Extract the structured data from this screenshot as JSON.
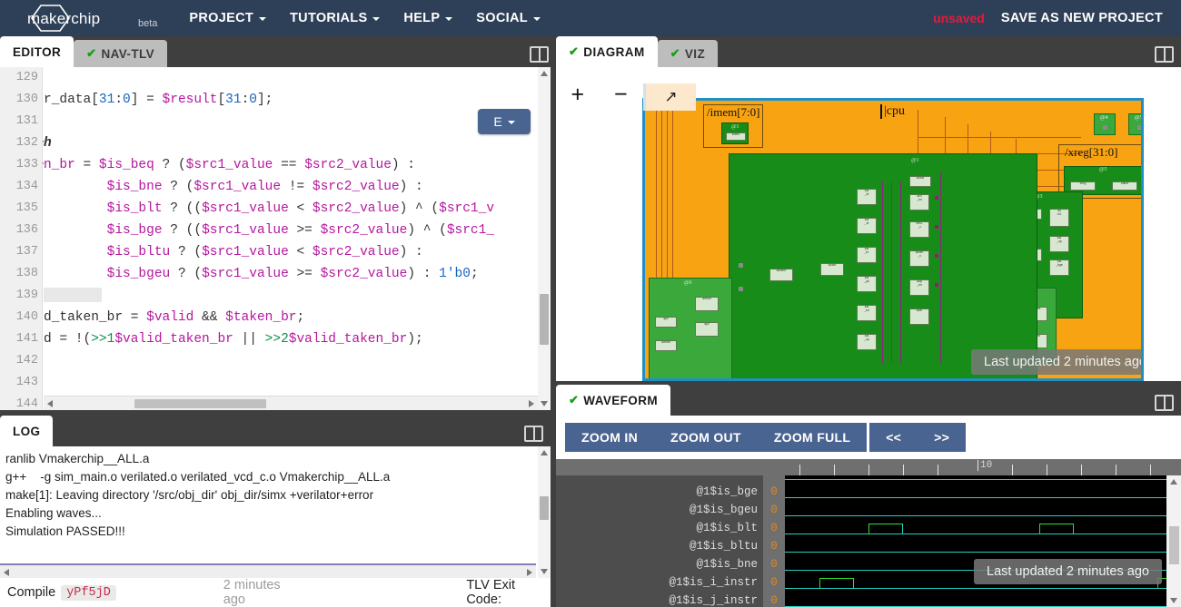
{
  "navbar": {
    "brand": "makerchip",
    "beta": "beta",
    "menus": [
      {
        "label": "PROJECT"
      },
      {
        "label": "TUTORIALS"
      },
      {
        "label": "HELP"
      },
      {
        "label": "SOCIAL"
      }
    ],
    "unsaved_label": "unsaved",
    "save_label": "SAVE AS NEW PROJECT",
    "unsaved_color": "#e8193c",
    "background": "#2e4057"
  },
  "editor": {
    "tabs": [
      {
        "label": "EDITOR",
        "active": true,
        "checked": false
      },
      {
        "label": "NAV-TLV",
        "active": false,
        "checked": true
      }
    ],
    "mode_button": "E",
    "line_numbers": [
      "129",
      "130",
      "131",
      "132",
      "133",
      "134",
      "135",
      "136",
      "137",
      "138",
      "139",
      "140",
      "141",
      "142",
      "143",
      "144"
    ],
    "lines": [
      {
        "num": "129",
        "fold": false,
        "text": ""
      },
      {
        "num": "130",
        "fold": false,
        "text": "r_data[31:0] = $result[31:0];"
      },
      {
        "num": "131",
        "fold": false,
        "text": ""
      },
      {
        "num": "132",
        "fold": true,
        "text": "h"
      },
      {
        "num": "133",
        "fold": true,
        "text": "n_br = $is_beq ? ($src1_value == $src2_value) :"
      },
      {
        "num": "134",
        "fold": false,
        "text": "        $is_bne ? ($src1_value != $src2_value) :"
      },
      {
        "num": "135",
        "fold": false,
        "text": "        $is_blt ? (($src1_value < $src2_value) ^ ($src1_v"
      },
      {
        "num": "136",
        "fold": false,
        "text": "        $is_bge ? (($src1_value >= $src2_value) ^ ($src1_"
      },
      {
        "num": "137",
        "fold": false,
        "text": "        $is_bltu ? ($src1_value < $src2_value) :"
      },
      {
        "num": "138",
        "fold": false,
        "text": "        $is_bgeu ? ($src1_value >= $src2_value) : 1'b0;"
      },
      {
        "num": "139",
        "fold": false,
        "text": ""
      },
      {
        "num": "140",
        "fold": false,
        "text": "d_taken_br = $valid && $taken_br;"
      },
      {
        "num": "141",
        "fold": false,
        "text": "d = !(>>1$valid_taken_br || >>2$valid_taken_br);"
      },
      {
        "num": "142",
        "fold": false,
        "text": ""
      },
      {
        "num": "143",
        "fold": false,
        "text": ""
      },
      {
        "num": "144",
        "fold": false,
        "text": ""
      }
    ]
  },
  "log": {
    "tab_label": "LOG",
    "text": "ranlib Vmakerchip__ALL.a\ng++    -g sim_main.o verilated.o verilated_vcd_c.o Vmakerchip__ALL.a\nmake[1]: Leaving directory '/src/obj_dir' obj_dir/simx +verilator+error\nEnabling waves...\nSimulation PASSED!!!",
    "status": {
      "compile_label": "Compile",
      "compile_id": "yPf5jD",
      "timestamp": "2 minutes ago",
      "exit_label": "TLV Exit Code:"
    }
  },
  "diagram": {
    "tabs": [
      {
        "label": "DIAGRAM",
        "active": true,
        "checked": true
      },
      {
        "label": "VIZ",
        "active": false,
        "checked": true
      }
    ],
    "controls": {
      "zoom_in": "+",
      "zoom_out": "−",
      "fit": "↗"
    },
    "canvas_color": "#f8a312",
    "border_color": "#1e90c8",
    "top_label": "|cpu",
    "block_labels": [
      "/xreg[31:0]",
      "/imem[7:0]"
    ],
    "stage_labels": [
      "@0",
      "@1",
      "@3",
      "@4",
      "@5"
    ],
    "toast": "Last updated 2 minutes ago"
  },
  "waveform": {
    "tab_label": "WAVEFORM",
    "buttons": [
      "ZOOM IN",
      "ZOOM OUT",
      "ZOOM FULL"
    ],
    "nav_buttons": [
      "<<",
      ">>"
    ],
    "ruler_label": "10",
    "toast": "Last updated 2 minutes ago",
    "signals": [
      {
        "name": "@1$is_bge",
        "value": "0"
      },
      {
        "name": "@1$is_bgeu",
        "value": "0"
      },
      {
        "name": "@1$is_blt",
        "value": "0"
      },
      {
        "name": "@1$is_bltu",
        "value": "0"
      },
      {
        "name": "@1$is_bne",
        "value": "0"
      },
      {
        "name": "@1$is_i_instr",
        "value": "0"
      },
      {
        "name": "@1$is_j_instr",
        "value": "0"
      }
    ]
  }
}
